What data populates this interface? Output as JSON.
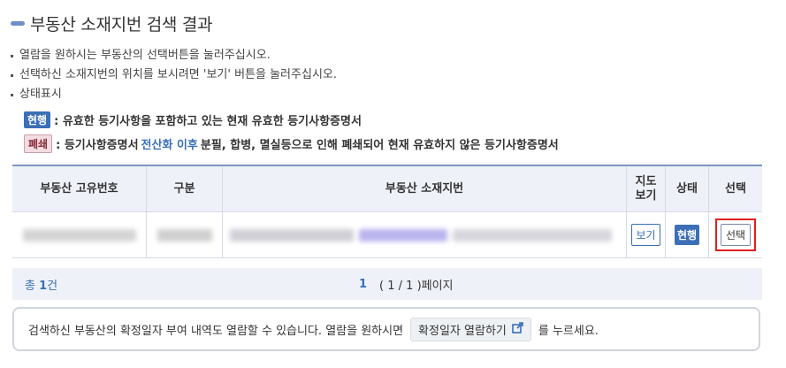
{
  "header": {
    "title": "부동산 소재지번 검색 결과"
  },
  "instructions": [
    "열람을 원하시는 부동산의 선택버튼을 눌러주십시오.",
    "선택하신 소재지번의 위치를 보시려면 '보기' 버튼을 눌러주십시오.",
    "상태표시"
  ],
  "legend": {
    "current_badge": "현행",
    "current_text": ": 유효한 등기사항을 포함하고 있는 현재 유효한 등기사항증명서",
    "closed_badge": "폐쇄",
    "closed_text_pre": ": 등기사항증명서",
    "closed_text_highlight": "전산화 이후",
    "closed_text_post": "분필, 합병, 멸실등으로 인해 폐쇄되어 현재 유효하지 않은 등기사항증명서"
  },
  "table": {
    "headers": {
      "unique_no": "부동산 고유번호",
      "category": "구분",
      "address": "부동산 소재지번",
      "map_view": "지도\n보기",
      "status": "상태",
      "select": "선택"
    },
    "row": {
      "view_button": "보기",
      "status_badge": "현행",
      "select_button": "선택"
    }
  },
  "pager": {
    "total_prefix": "총",
    "total_count": "1",
    "total_suffix": "건",
    "current_page": "1",
    "page_info": "( 1 / 1 )페이지"
  },
  "notice": {
    "text_pre": "검색하신 부동산의 확정일자 부여 내역도 열람할 수 있습니다. 열람을 원하시면",
    "button_label": "확정일자 열람하기",
    "text_post": "를 누르세요."
  },
  "colors": {
    "accent": "#3b6fb6",
    "highlight_border": "#e02020",
    "header_bg": "#eef1f7"
  }
}
